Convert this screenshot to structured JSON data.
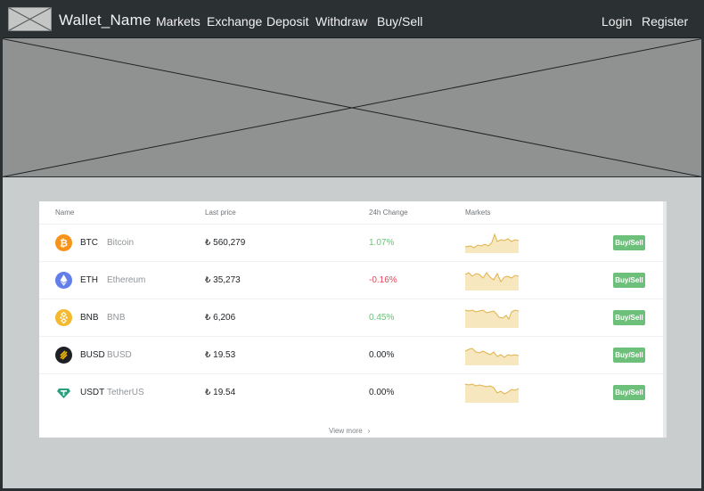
{
  "nav": {
    "brand": "Wallet_Name",
    "links": [
      "Markets",
      "Exchange",
      "Deposit",
      "Withdraw",
      "Buy/Sell"
    ],
    "login": "Login",
    "register": "Register"
  },
  "market_table": {
    "headers": {
      "name": "Name",
      "last_price": "Last price",
      "change": "24h Change",
      "markets": "Markets"
    },
    "rows": [
      {
        "symbol": "BTC",
        "name": "Bitcoin",
        "price": "₺ 560,279",
        "change": "1.07%",
        "icon": "bitcoin-icon",
        "icon_color": "#f7931a",
        "buy_label": "Buy/Sell"
      },
      {
        "symbol": "ETH",
        "name": "Ethereum",
        "price": "₺ 35,273",
        "change": "-0.16%",
        "icon": "ethereum-icon",
        "icon_color": "#627eea",
        "buy_label": "Buy/Sell"
      },
      {
        "symbol": "BNB",
        "name": "BNB",
        "price": "₺ 6,206",
        "change": "0.45%",
        "icon": "bnb-icon",
        "icon_color": "#f3ba2f",
        "buy_label": "Buy/Sell"
      },
      {
        "symbol": "BUSD",
        "name": "BUSD",
        "price": "₺ 19.53",
        "change": "0.00%",
        "icon": "busd-icon",
        "icon_color": "#1e2026",
        "buy_label": "Buy/Sell"
      },
      {
        "symbol": "USDT",
        "name": "TetherUS",
        "price": "₺ 19.54",
        "change": "0.00%",
        "icon": "tether-icon",
        "icon_color": "#26a17b",
        "buy_label": "Buy/Sell"
      }
    ],
    "view_more": "View more"
  },
  "colors": {
    "positive": "#6cc07a",
    "negative": "#e0465a",
    "neutral": "#1e2226",
    "sparkline_stroke": "#e0b24a",
    "sparkline_fill": "#f6e7bf",
    "button": "#6cc07a",
    "nav_bg": "#2b3032",
    "hero_bg": "#909292",
    "page_bg": "#c9cdcd"
  }
}
